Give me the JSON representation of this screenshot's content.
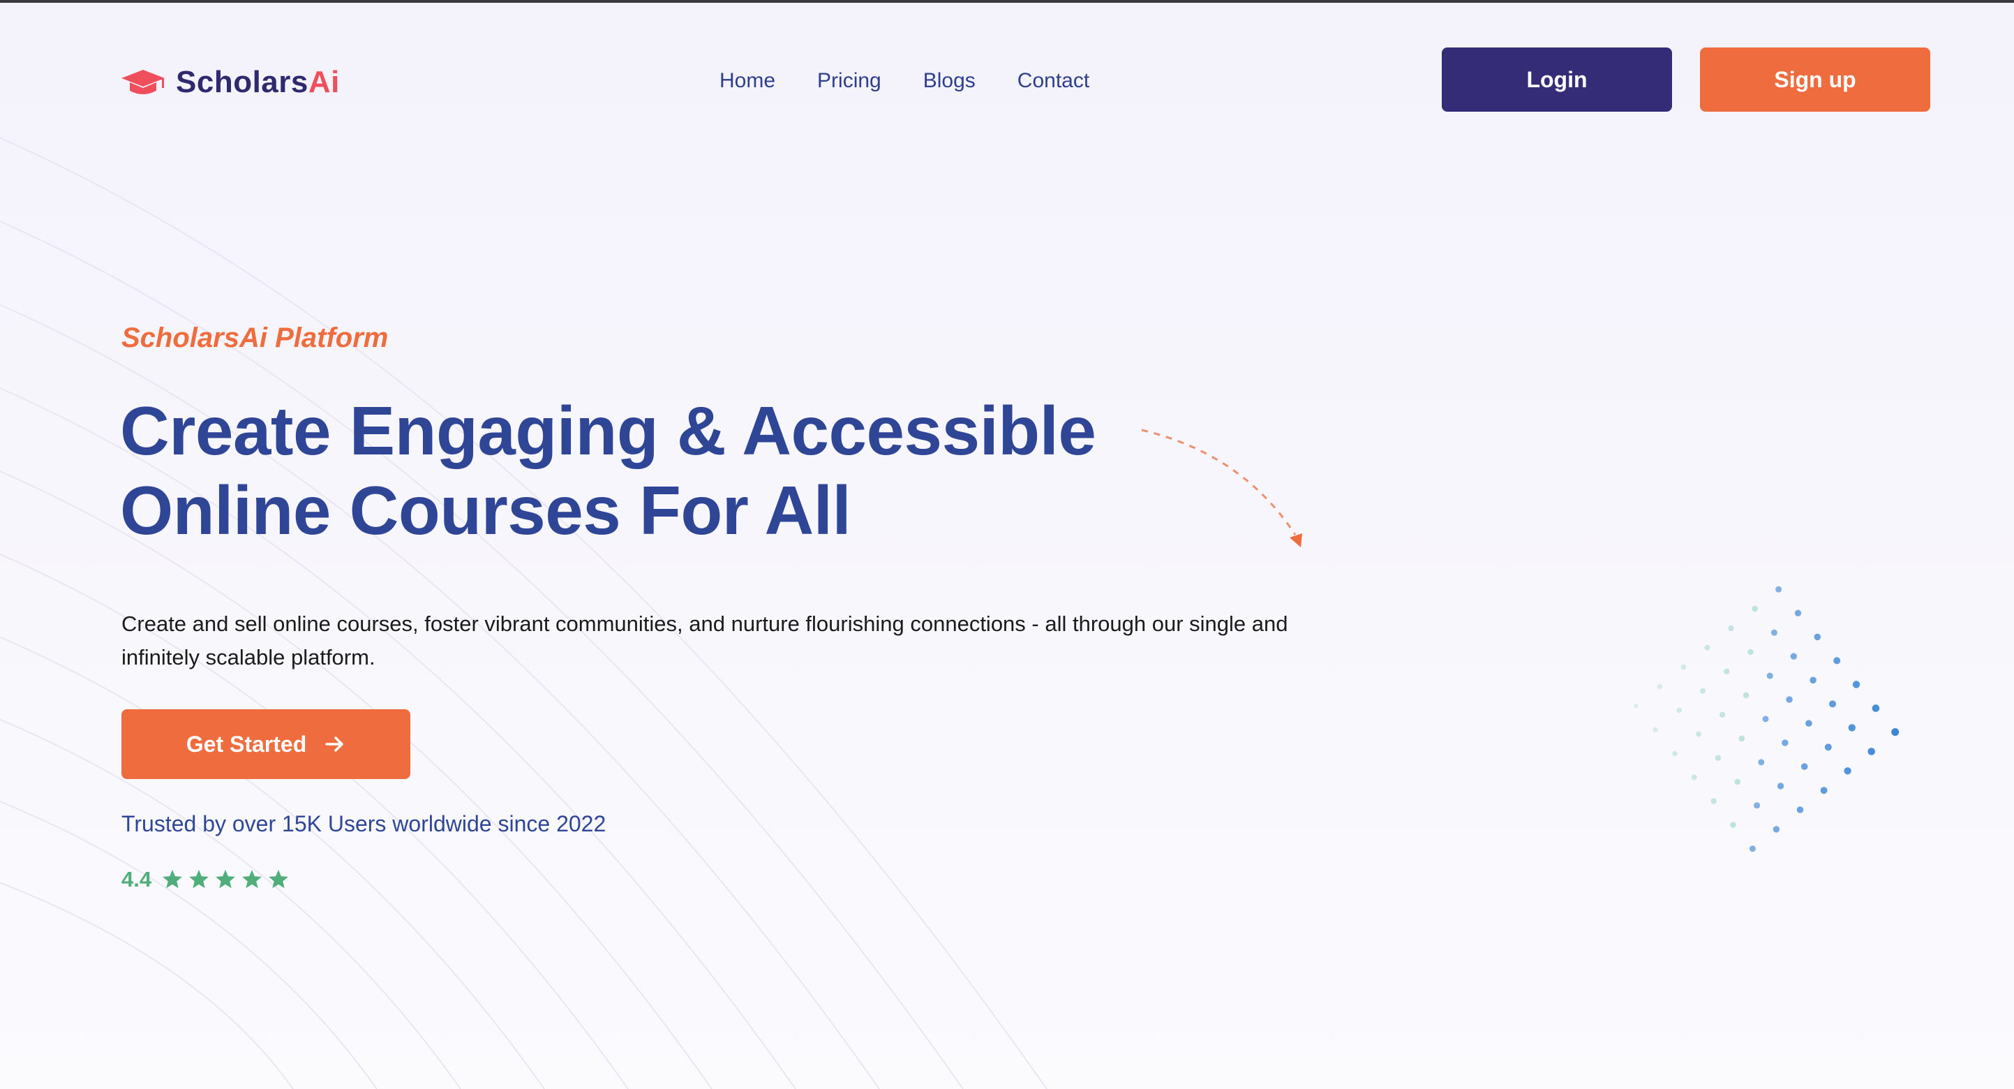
{
  "brand": {
    "name_primary": "Scholars",
    "name_accent": "Ai",
    "logo_icon": "graduation-cap-icon"
  },
  "nav": {
    "items": [
      {
        "label": "Home"
      },
      {
        "label": "Pricing"
      },
      {
        "label": "Blogs"
      },
      {
        "label": "Contact"
      }
    ]
  },
  "header": {
    "login_label": "Login",
    "signup_label": "Sign up"
  },
  "hero": {
    "eyebrow": "ScholarsAi Platform",
    "headline_line1": "Create Engaging & Accessible",
    "headline_line2": "Online Courses For All",
    "subtext": "Create and sell online courses, foster vibrant communities, and nurture flourishing connections - all through our single and infinitely scalable platform.",
    "cta_label": "Get Started",
    "cta_icon": "arrow-right-icon",
    "trust_text": "Trusted by over 15K Users worldwide since 2022",
    "rating_value": "4.4",
    "rating_stars": 5
  },
  "colors": {
    "primary": "#352c78",
    "accent": "#ef6c3e",
    "heading": "#2f4696",
    "logo_accent": "#ef4f5a",
    "rating": "#4fae7a"
  }
}
